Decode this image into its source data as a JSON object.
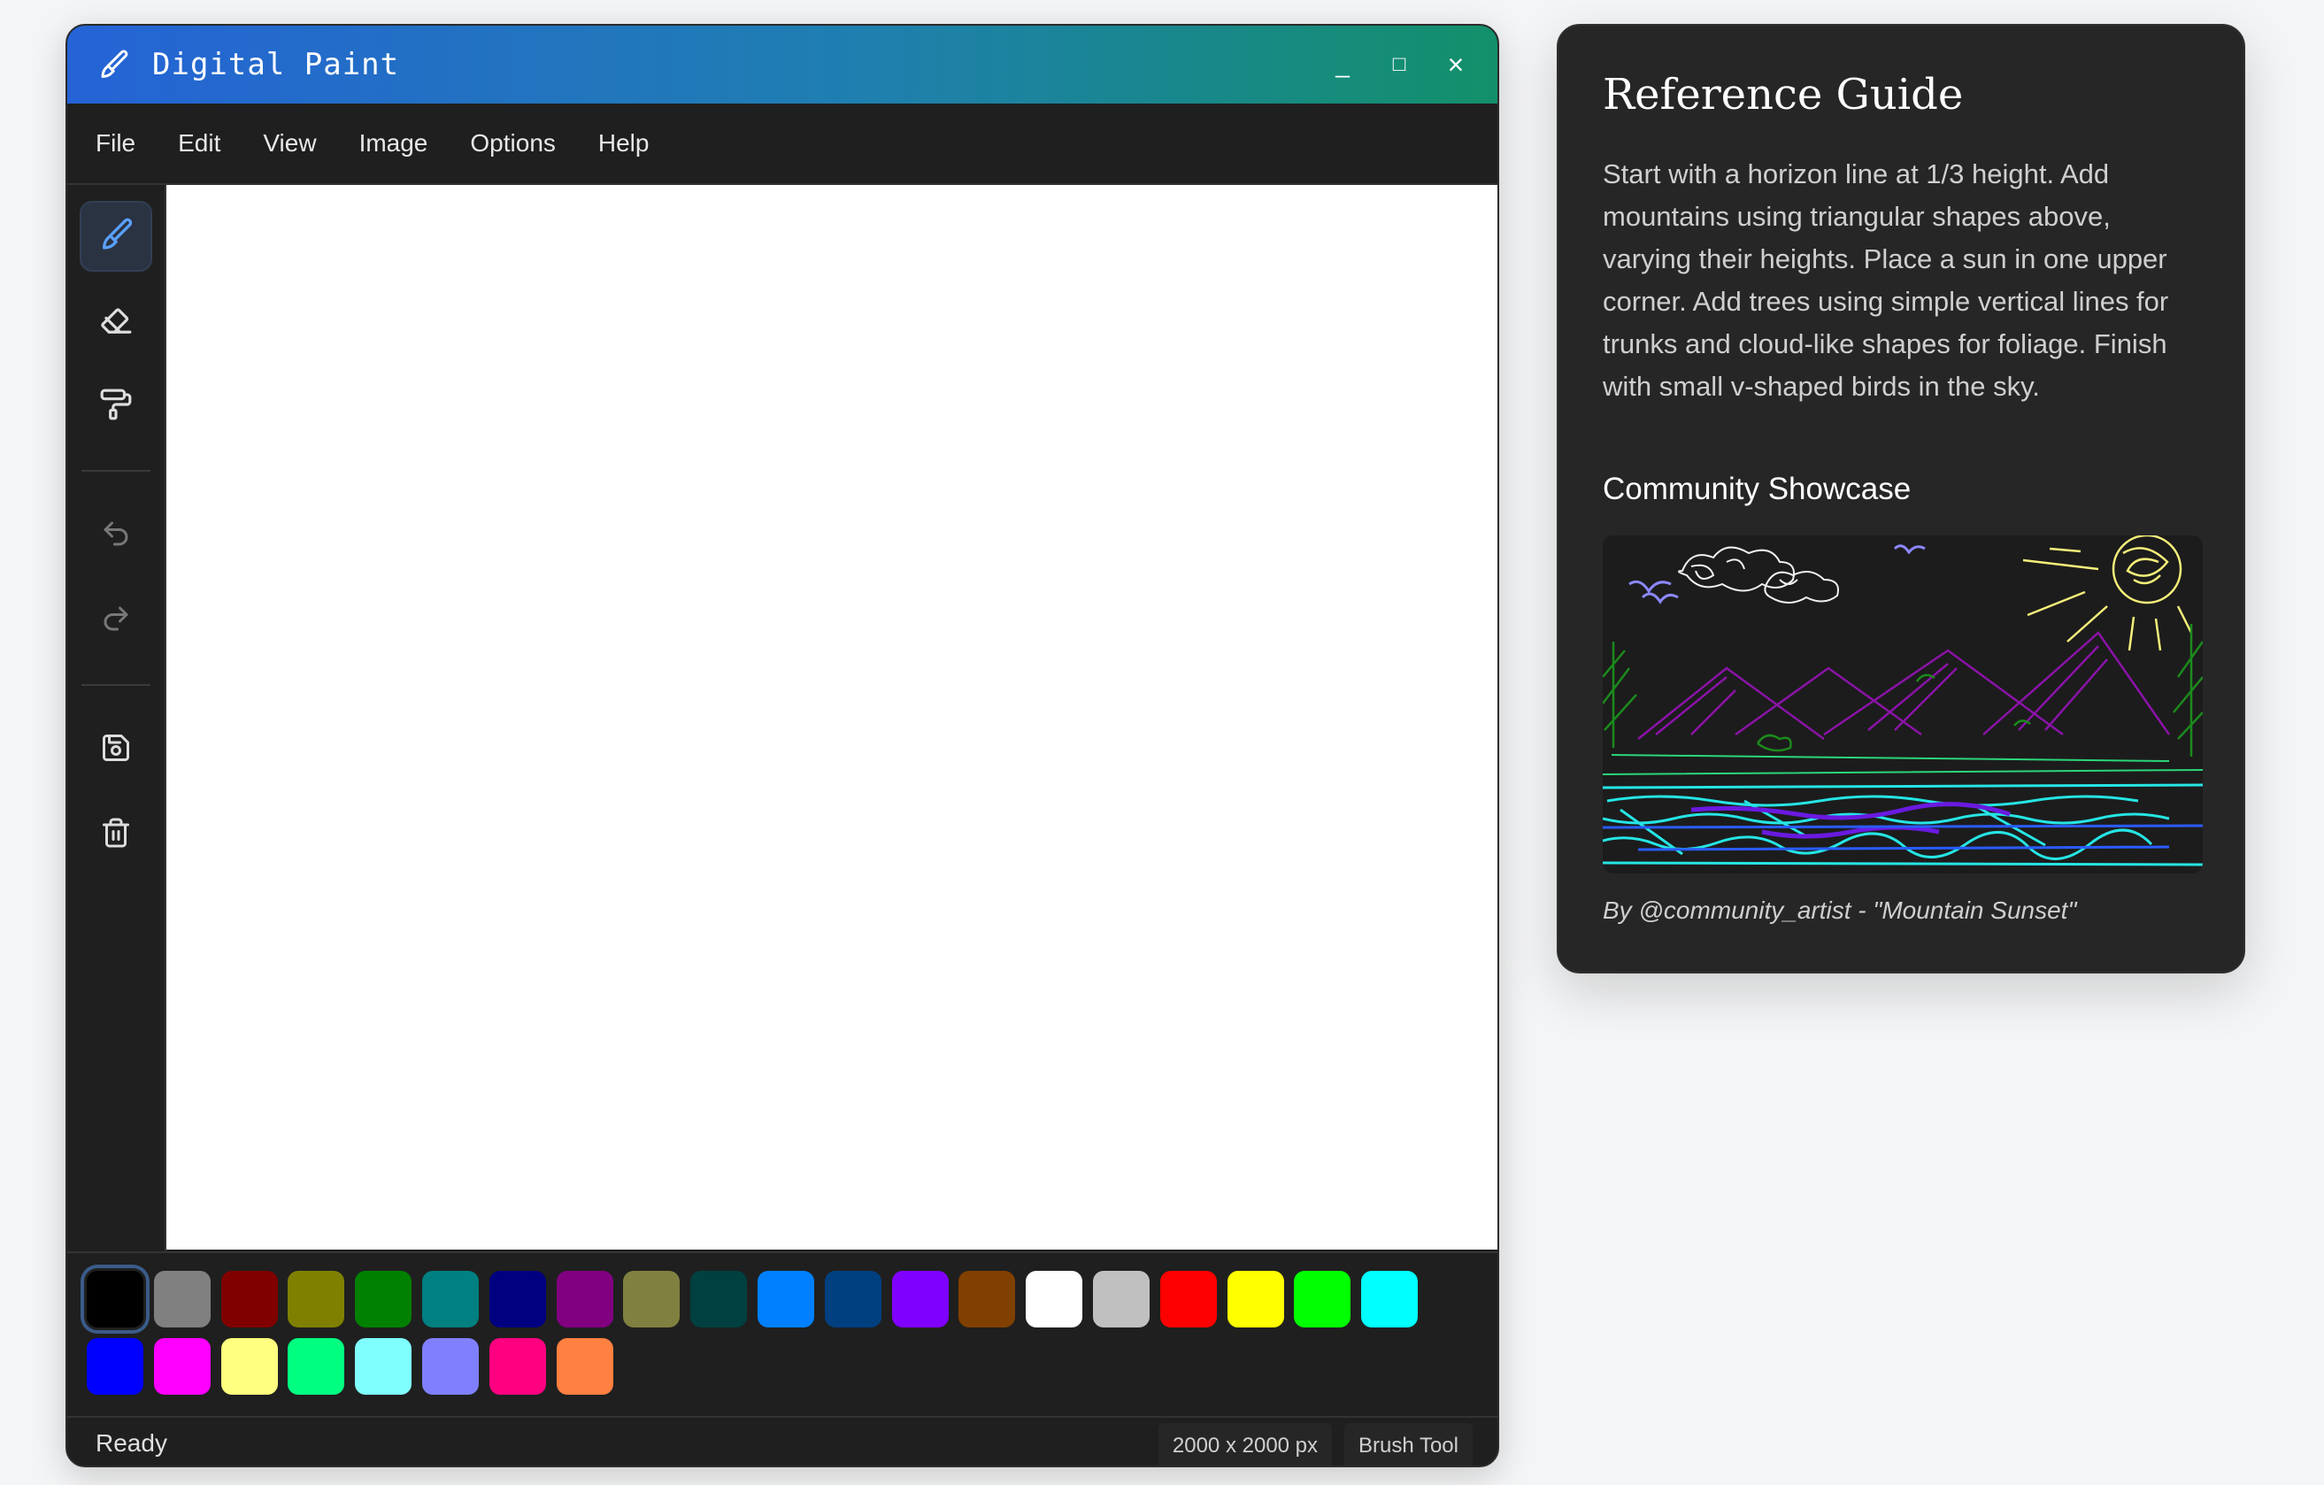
{
  "window": {
    "title": "Digital Paint",
    "controls": {
      "minimize": "_",
      "maximize": "□",
      "close": "×"
    }
  },
  "menu": [
    "File",
    "Edit",
    "View",
    "Image",
    "Options",
    "Help"
  ],
  "tools": [
    {
      "name": "brush-tool",
      "icon": "brush-icon",
      "active": true
    },
    {
      "name": "eraser-tool",
      "icon": "eraser-icon",
      "active": false
    },
    {
      "name": "fill-tool",
      "icon": "paint-roller-icon",
      "active": false
    },
    {
      "name": "undo-button",
      "icon": "undo-icon",
      "active": false
    },
    {
      "name": "redo-button",
      "icon": "redo-icon",
      "active": false
    },
    {
      "name": "save-button",
      "icon": "save-icon",
      "active": false
    },
    {
      "name": "clear-button",
      "icon": "trash-icon",
      "active": false
    }
  ],
  "palette": {
    "row1": [
      "#000000",
      "#808080",
      "#800000",
      "#808000",
      "#008000",
      "#008080",
      "#000080",
      "#800080",
      "#808040",
      "#004040",
      "#0080ff",
      "#004080",
      "#8000ff",
      "#804000",
      "#ffffff",
      "#c0c0c0",
      "#ff0000",
      "#ffff00",
      "#00ff00",
      "#00ffff"
    ],
    "row2": [
      "#0000ff",
      "#ff00ff",
      "#ffff80",
      "#00ff80",
      "#80ffff",
      "#8080ff",
      "#ff0080",
      "#ff8040"
    ],
    "selected": "#000000"
  },
  "status": {
    "left": "Ready",
    "dimensions": "2000 x 2000 px",
    "tool": "Brush Tool"
  },
  "reference": {
    "title": "Reference Guide",
    "body": "Start with a horizon line at 1/3 height. Add mountains using triangular shapes above, varying their heights. Place a sun in one upper corner. Add trees using simple vertical lines for trunks and cloud-like shapes for foliage. Finish with small v-shaped birds in the sky.",
    "showcase_heading": "Community Showcase",
    "caption": "By @community_artist - \"Mountain Sunset\""
  }
}
